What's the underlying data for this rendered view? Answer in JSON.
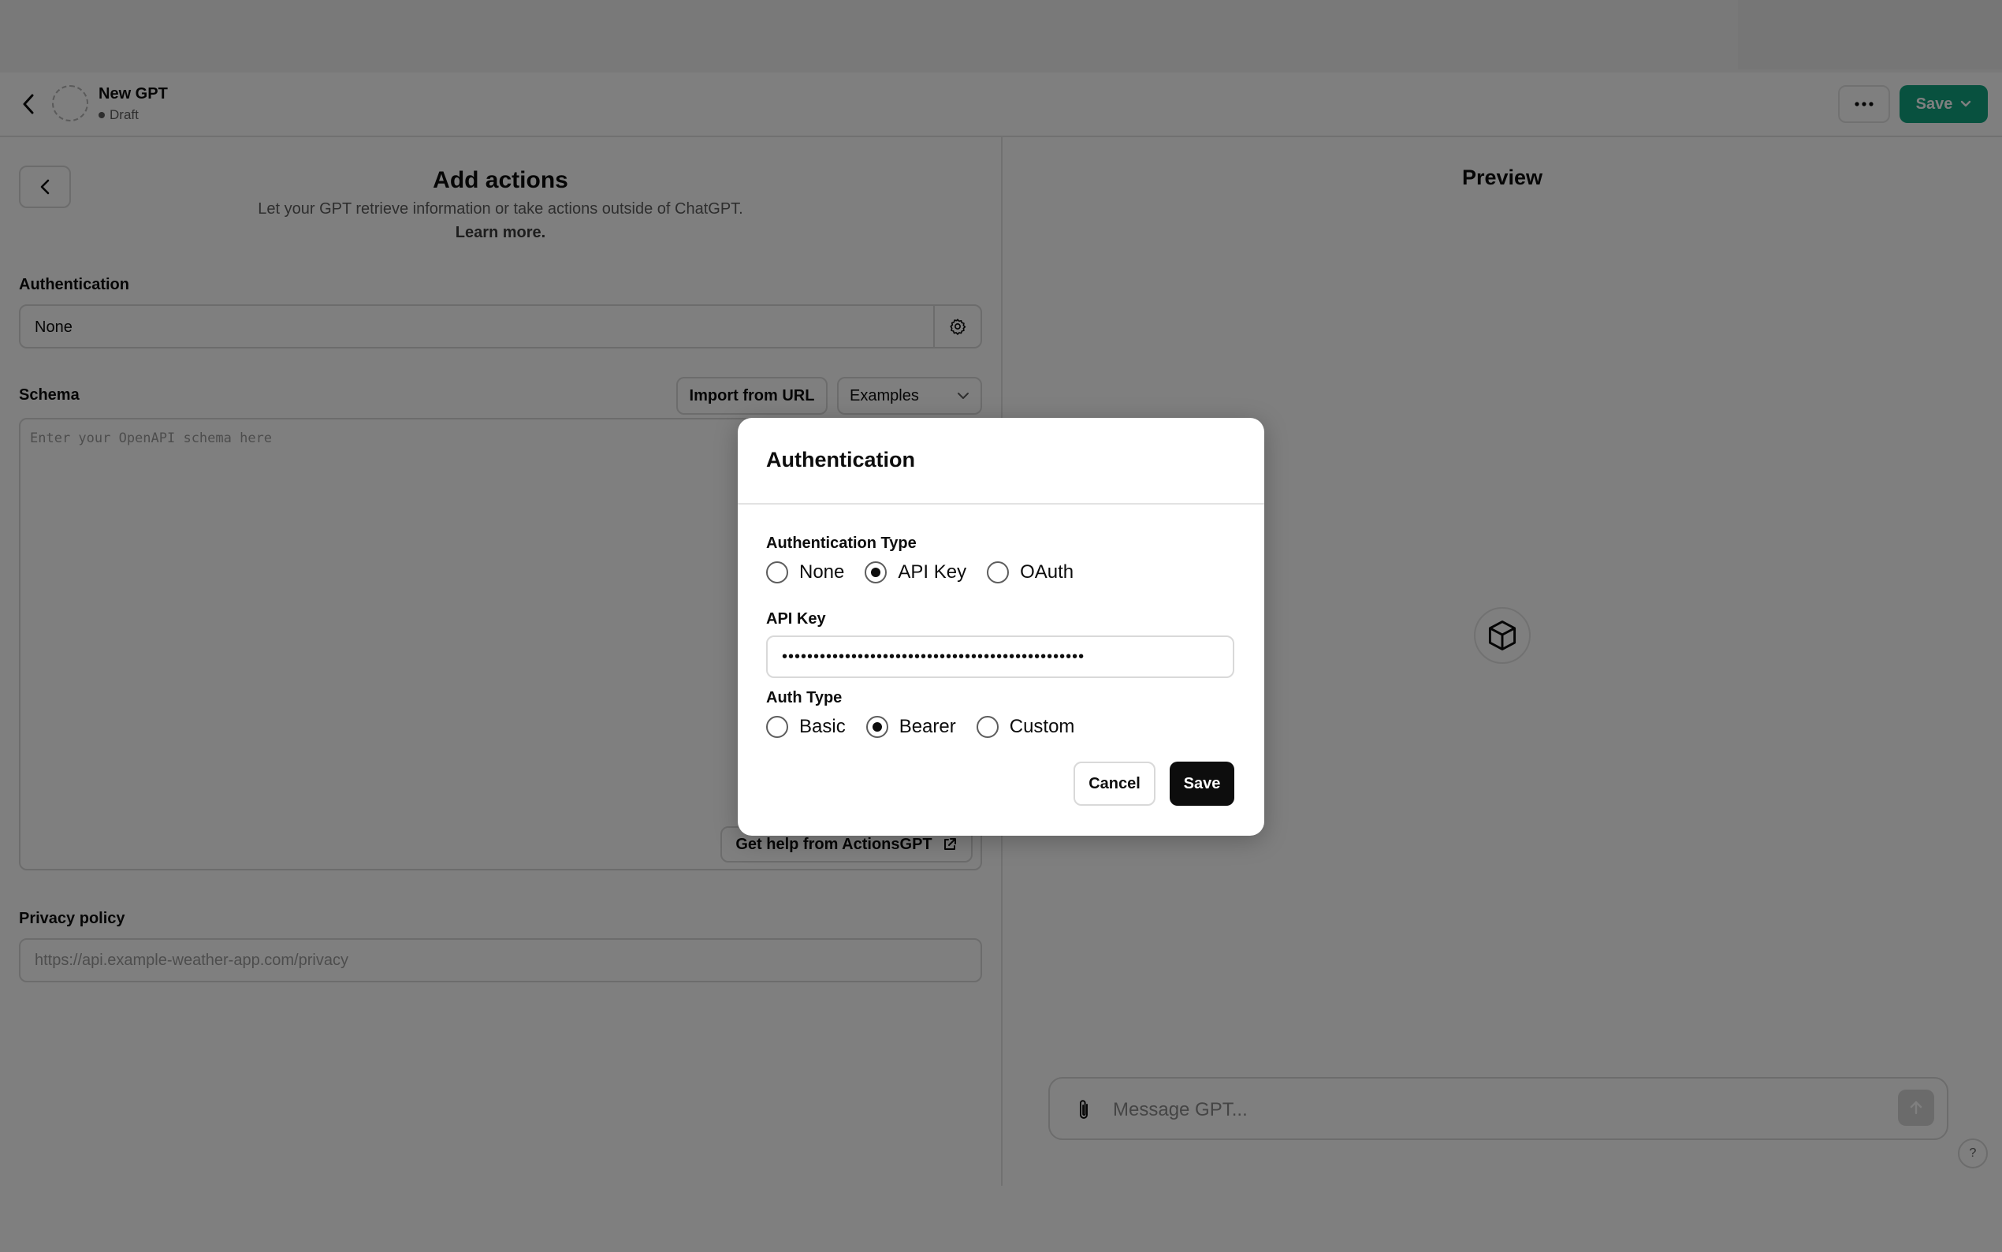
{
  "header": {
    "back_icon": "chevron-left-icon",
    "gpt_name": "New GPT",
    "gpt_status": "Draft",
    "more_icon": "ellipsis-icon",
    "save_label": "Save",
    "save_color": "#10a37f"
  },
  "actions": {
    "title": "Add actions",
    "description": "Let your GPT retrieve information or take actions outside of ChatGPT.",
    "learn_more": "Learn more.",
    "authentication_label": "Authentication",
    "authentication_value": "None",
    "schema_label": "Schema",
    "import_label": "Import from URL",
    "examples_label": "Examples",
    "schema_placeholder": "Enter your OpenAPI schema here",
    "help_label": "Get help from ActionsGPT",
    "privacy_label": "Privacy policy",
    "privacy_placeholder": "https://api.example-weather-app.com/privacy"
  },
  "preview": {
    "title": "Preview",
    "message_placeholder": "Message GPT...",
    "help": "?"
  },
  "modal": {
    "title": "Authentication",
    "auth_type_label": "Authentication Type",
    "auth_type_options": [
      "None",
      "API Key",
      "OAuth"
    ],
    "auth_type_selected": "API Key",
    "api_key_label": "API Key",
    "api_key_value": "••••••••••••••••••••••••••••••••••••••••••••••••",
    "auth_subtype_label": "Auth Type",
    "auth_subtype_options": [
      "Basic",
      "Bearer",
      "Custom"
    ],
    "auth_subtype_selected": "Bearer",
    "cancel_label": "Cancel",
    "save_label": "Save"
  }
}
